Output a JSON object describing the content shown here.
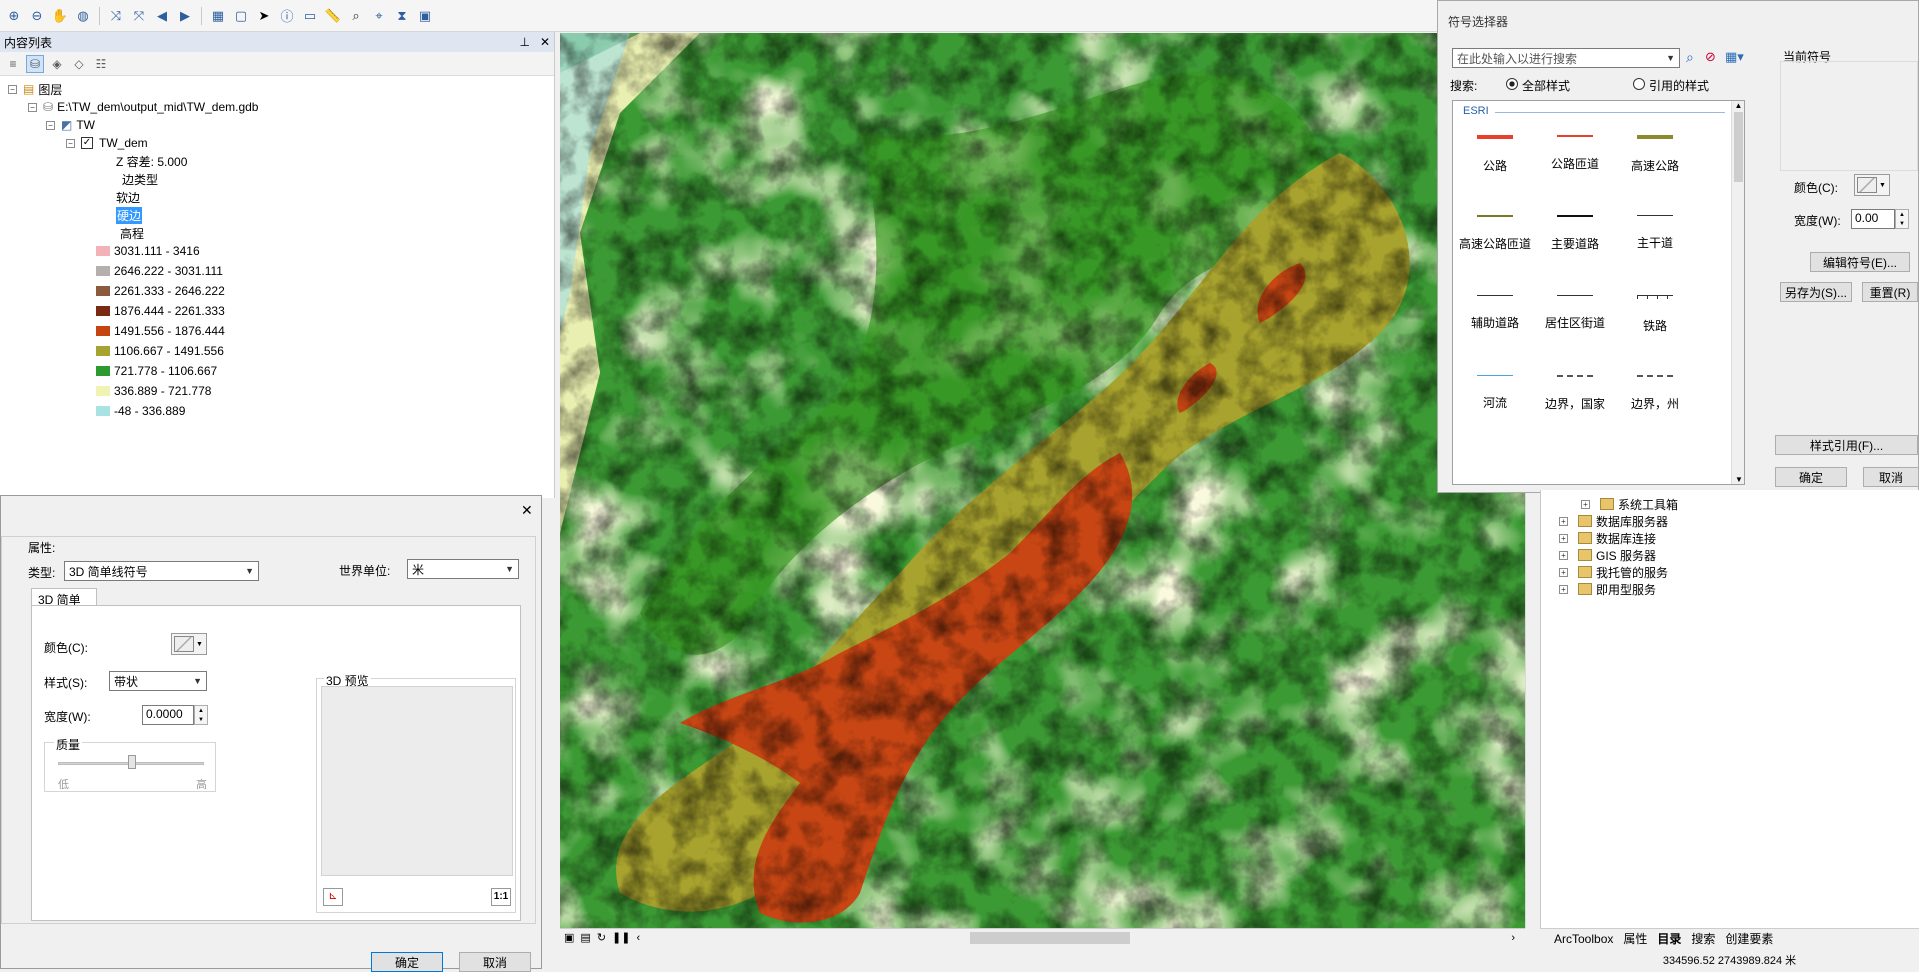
{
  "toolbar": {
    "icons": [
      "zoom-in-icon",
      "zoom-out-icon",
      "pan-icon",
      "full-extent-icon",
      "fixed-zoom-in-icon",
      "fixed-zoom-out-icon",
      "back-icon",
      "forward-icon",
      "select-elements-icon",
      "clear-selection-icon",
      "select-icon",
      "identify-icon",
      "html-popup-icon",
      "measure-icon",
      "find-icon",
      "go-to-xy-icon",
      "time-slider-icon",
      "viewer-icon"
    ]
  },
  "toc": {
    "title": "内容列表",
    "pin": "⊥",
    "close": "✕",
    "root": "图层",
    "gdb": "E:\\TW_dem\\output_mid\\TW_dem.gdb",
    "tin_group": "TW",
    "tin_layer": "TW_dem",
    "z_tolerance": "Z 容差: 5.000",
    "edge_type": "边类型",
    "soft_edge": "软边",
    "hard_edge": "硬边",
    "elevation": "高程",
    "legend": [
      {
        "label": "3031.111 - 3416",
        "color": "#f2b2b8"
      },
      {
        "label": "2646.222 - 3031.111",
        "color": "#b5b0ad"
      },
      {
        "label": "2261.333 - 2646.222",
        "color": "#8c5a3c"
      },
      {
        "label": "1876.444 - 2261.333",
        "color": "#7a2a12"
      },
      {
        "label": "1491.556 - 1876.444",
        "color": "#c4450f"
      },
      {
        "label": "1106.667 - 1491.556",
        "color": "#a6a330"
      },
      {
        "label": "721.778 - 1106.667",
        "color": "#2b9a2f"
      },
      {
        "label": "336.889 - 721.778",
        "color": "#f1f3b3"
      },
      {
        "label": "-48 - 336.889",
        "color": "#a9e2e3"
      }
    ]
  },
  "props": {
    "group_label": "属性:",
    "type_label": "类型:",
    "type_value": "3D 简单线符号",
    "world_units_label": "世界单位:",
    "world_units_value": "米",
    "tab": "3D 简单线",
    "color_label": "颜色(C):",
    "style_label": "样式(S):",
    "style_value": "带状",
    "width_label": "宽度(W):",
    "width_value": "0.0000",
    "quality_label": "质量",
    "low": "低",
    "high": "高",
    "preview_label": "3D 预览",
    "one_to_one": "1:1",
    "ok": "确定",
    "cancel": "取消"
  },
  "symbol_selector": {
    "title": "符号选择器",
    "search_placeholder": "在此处输入以进行搜索",
    "search_label": "搜索:",
    "all_styles": "全部样式",
    "referenced_styles": "引用的样式",
    "group": "ESRI",
    "current_symbol": "当前符号",
    "color_label": "颜色(C):",
    "width_label": "宽度(W):",
    "width_value": "0.00",
    "edit_symbol": "编辑符号(E)...",
    "save_as": "另存为(S)...",
    "reset": "重置(R)",
    "style_references": "样式引用(F)...",
    "ok": "确定",
    "cancel": "取消",
    "items": [
      {
        "label": "公路",
        "color": "#e8402a",
        "weight": 4,
        "dash": "none"
      },
      {
        "label": "公路匝道",
        "color": "#e8402a",
        "weight": 2,
        "dash": "none"
      },
      {
        "label": "高速公路",
        "color": "#8c8a2a",
        "weight": 4,
        "dash": "none"
      },
      {
        "label": "高速公路匝道",
        "color": "#7a7a22",
        "weight": 2,
        "dash": "none"
      },
      {
        "label": "主要道路",
        "color": "#111111",
        "weight": 2,
        "dash": "none"
      },
      {
        "label": "主干道",
        "color": "#333333",
        "weight": 1,
        "dash": "none"
      },
      {
        "label": "辅助道路",
        "color": "#333333",
        "weight": 1,
        "dash": "none"
      },
      {
        "label": "居住区街道",
        "color": "#333333",
        "weight": 1,
        "dash": "none"
      },
      {
        "label": "铁路",
        "color": "#333333",
        "weight": 1,
        "dash": "rail"
      },
      {
        "label": "河流",
        "color": "#4aa3df",
        "weight": 1,
        "dash": "none"
      },
      {
        "label": "边界，国家",
        "color": "#555555",
        "weight": 2,
        "dash": "dash"
      },
      {
        "label": "边界，州",
        "color": "#555555",
        "weight": 2,
        "dash": "dash"
      }
    ]
  },
  "catalog": {
    "items": [
      "系统工具箱",
      "数据库服务器",
      "数据库连接",
      "GIS 服务器",
      "我托管的服务",
      "即用型服务"
    ],
    "tabs": [
      "ArcToolbox",
      "属性",
      "目录",
      "搜索",
      "创建要素"
    ]
  },
  "status": {
    "coordinates": "334596.52  2743989.824 米"
  }
}
